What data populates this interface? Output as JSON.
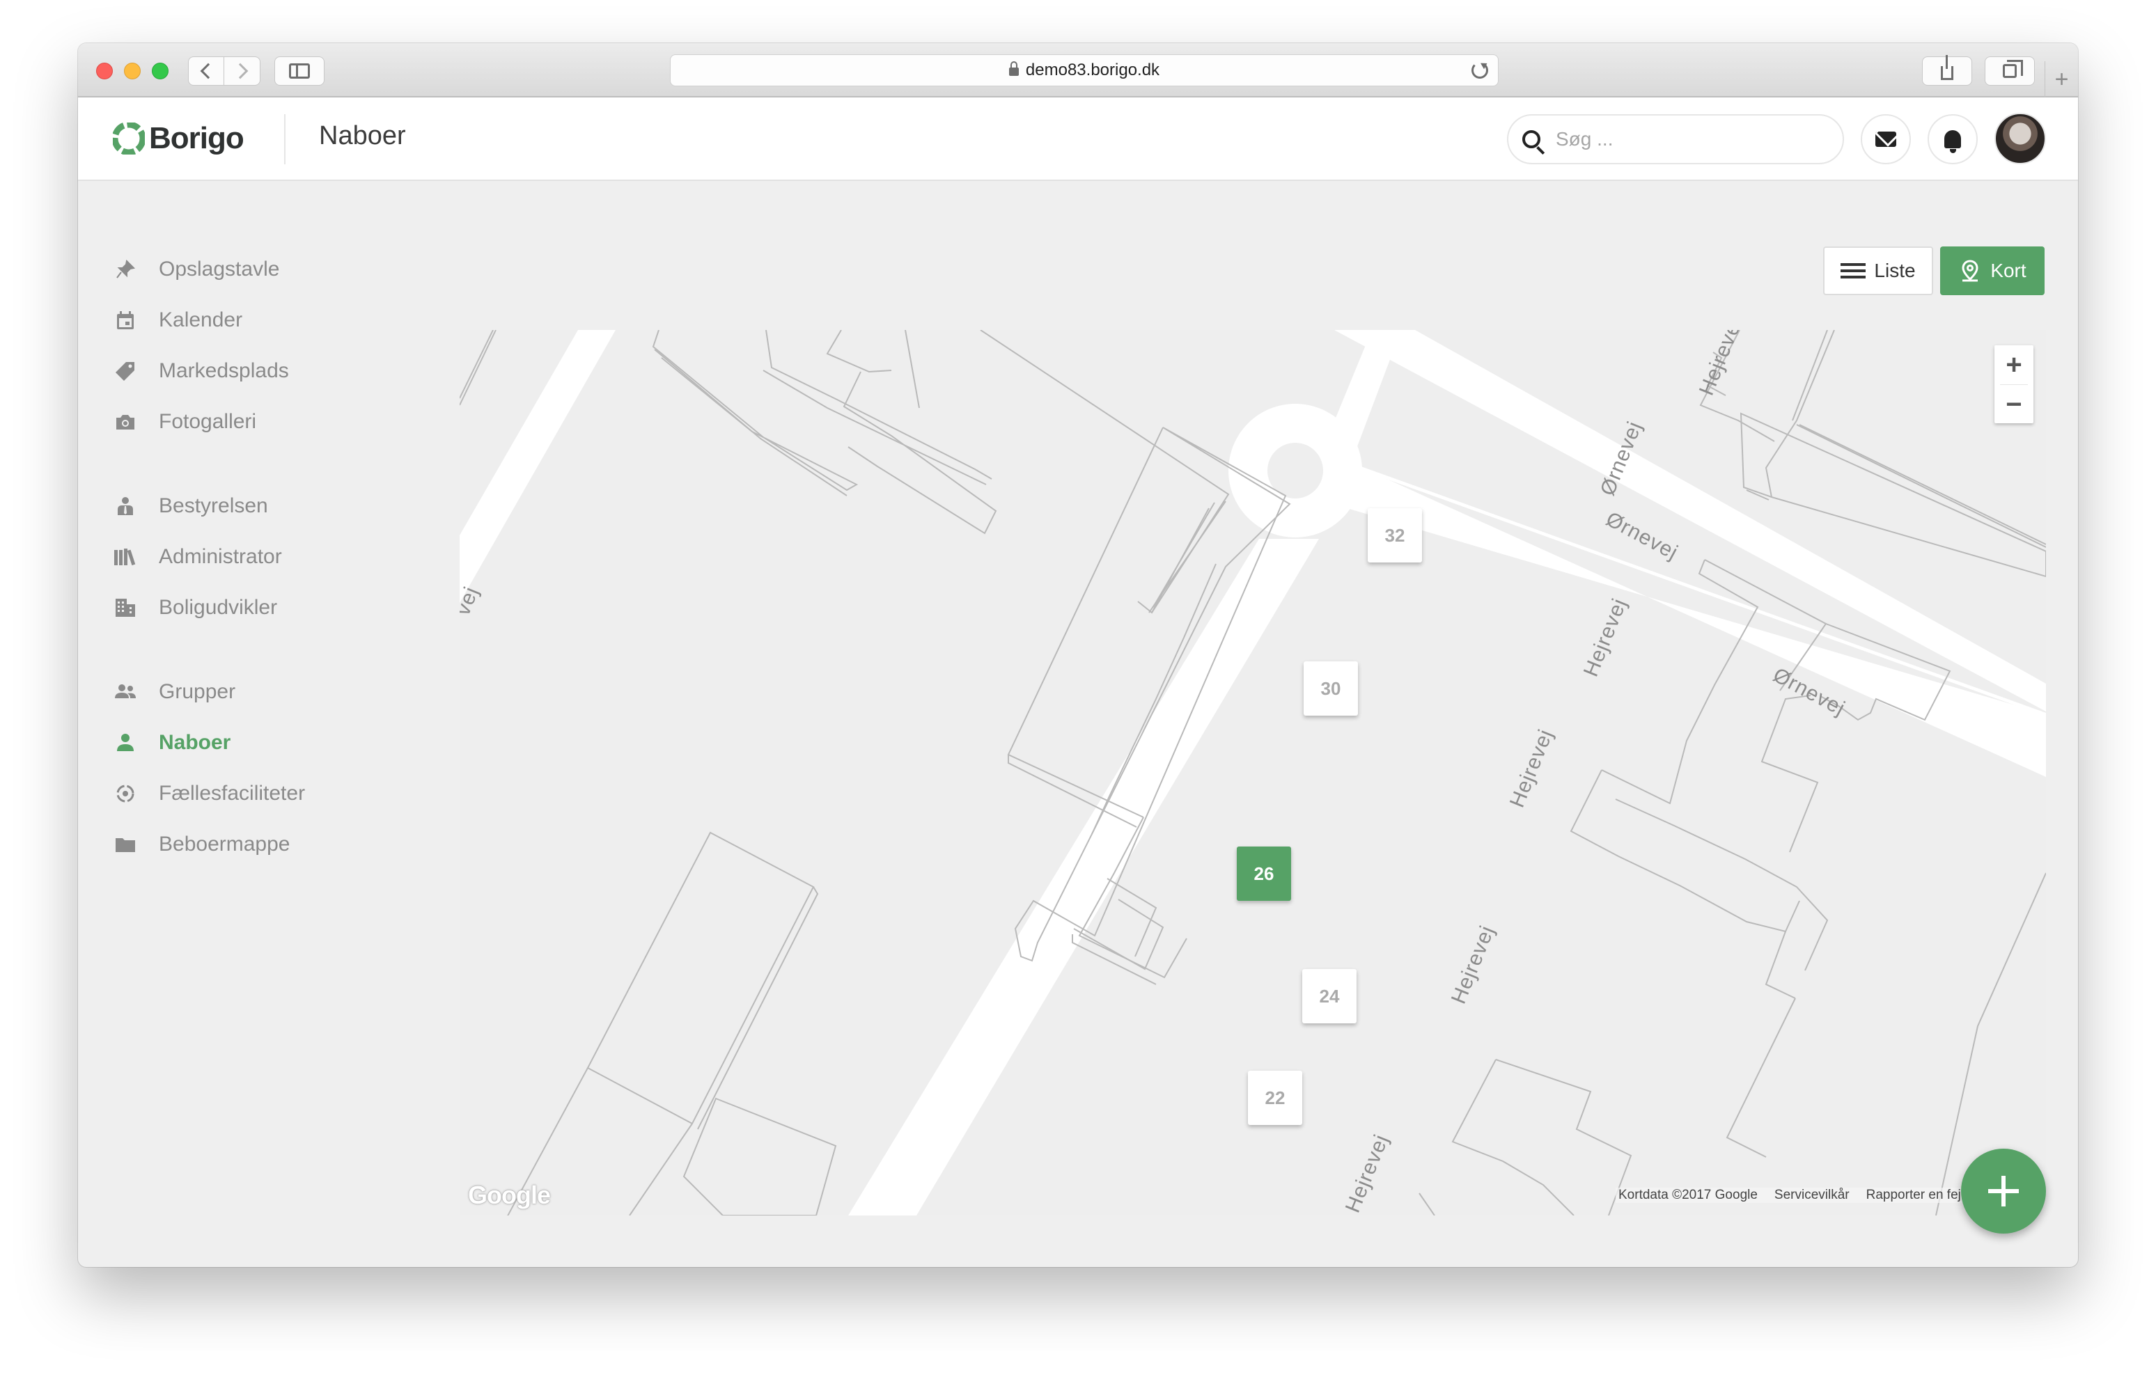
{
  "browser": {
    "url": "demo83.borigo.dk"
  },
  "header": {
    "logo_text": "Borigo",
    "page_title": "Naboer",
    "search_placeholder": "Søg ...",
    "brand_color": "#56a266"
  },
  "sidebar": {
    "groups": [
      [
        {
          "label": "Opslagstavle",
          "icon": "pin-icon"
        },
        {
          "label": "Kalender",
          "icon": "calendar-icon"
        },
        {
          "label": "Markedsplads",
          "icon": "tag-icon"
        },
        {
          "label": "Fotogalleri",
          "icon": "camera-icon"
        }
      ],
      [
        {
          "label": "Bestyrelsen",
          "icon": "person-tie-icon"
        },
        {
          "label": "Administrator",
          "icon": "books-icon"
        },
        {
          "label": "Boligudvikler",
          "icon": "building-icon"
        }
      ],
      [
        {
          "label": "Grupper",
          "icon": "group-icon"
        },
        {
          "label": "Naboer",
          "icon": "person-icon",
          "active": true
        },
        {
          "label": "Fællesfaciliteter",
          "icon": "facilities-icon"
        },
        {
          "label": "Beboermappe",
          "icon": "folder-icon"
        }
      ]
    ]
  },
  "view_toggle": {
    "list_label": "Liste",
    "map_label": "Kort",
    "selected": "Kort"
  },
  "map": {
    "markers": [
      {
        "label": "32",
        "active": false
      },
      {
        "label": "30",
        "active": false
      },
      {
        "label": "26",
        "active": true
      },
      {
        "label": "24",
        "active": false
      },
      {
        "label": "22",
        "active": false
      }
    ],
    "street_labels": {
      "hejrevej": "Hejrevej",
      "ornevej": "Ørnevej",
      "partial": "vej"
    },
    "zoom_in": "+",
    "zoom_out": "−",
    "google_logo": "Google",
    "attribution": {
      "kortdata": "Kortdata ©2017 Google",
      "terms": "Servicevilkår",
      "report": "Rapporter en fejl"
    }
  },
  "fab_label": "+"
}
